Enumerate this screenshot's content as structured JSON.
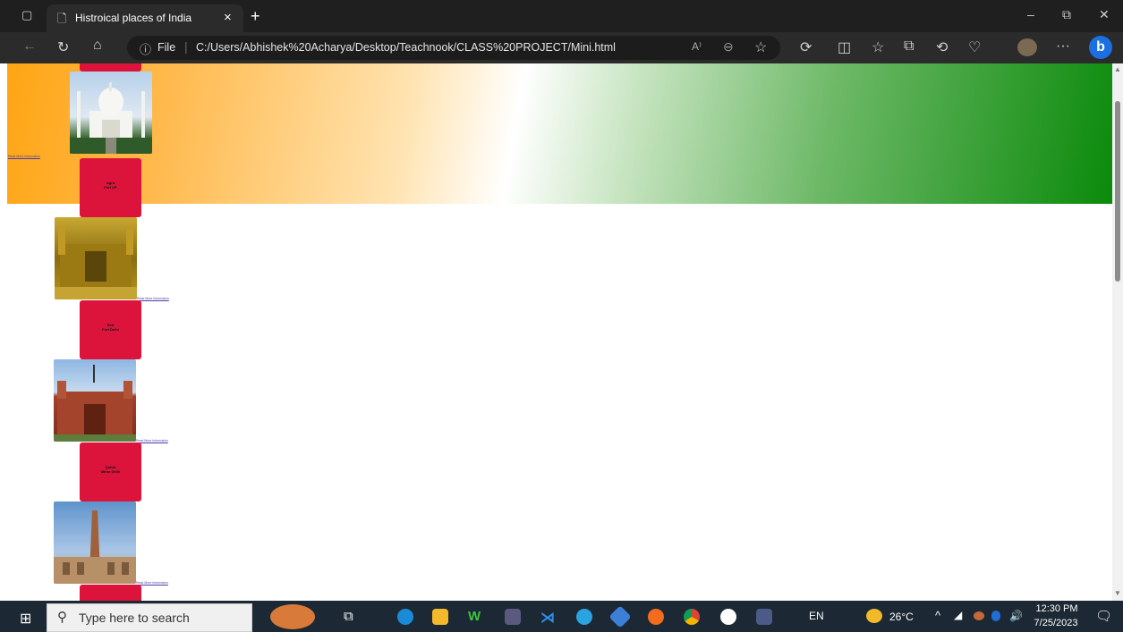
{
  "browser": {
    "tab_title": "Histroical places of India",
    "tab_close": "×",
    "new_tab": "+",
    "file_label": "File",
    "url": "C:/Users/Abhishek%20Acharya/Desktop/Teachnook/CLASS%20PROJECT/Mini.html",
    "window_controls": {
      "minimize": "–",
      "restore": "⧉",
      "close": "✕"
    },
    "more": "···"
  },
  "page": {
    "banner_colors": {
      "saffron": "#ffa514",
      "white": "#ffffff",
      "green": "#0b8a0b"
    },
    "card_color": "#dc143c",
    "read_more": "Read More Information",
    "places": [
      {
        "name_line1": "Taj",
        "name_line2": "Mahal",
        "read_more": "Read More Information"
      },
      {
        "name_line1": "Agra",
        "name_line2": "Fort UP",
        "read_more": "Read More Information"
      },
      {
        "name_line1": "Red",
        "name_line2": "Fort Delhi",
        "read_more": "Read More Information"
      },
      {
        "name_line1": "Qutub",
        "name_line2": "Minar Delhi",
        "read_more": "Read More Information"
      }
    ]
  },
  "taskbar": {
    "search_placeholder": "Type here to search",
    "language": "EN",
    "temperature": "26°C",
    "time": "12:30 PM",
    "date": "7/25/2023"
  }
}
